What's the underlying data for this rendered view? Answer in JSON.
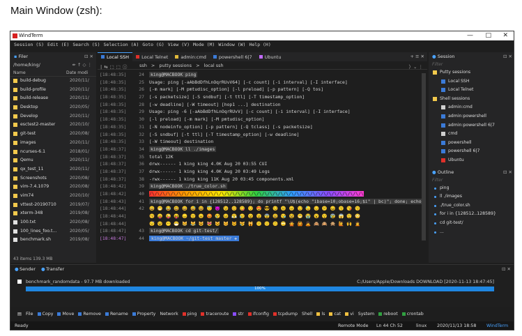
{
  "caption": "Main Window (zsh):",
  "window": {
    "title": "WindTerm",
    "min": "—",
    "max": "□",
    "close": "✕"
  },
  "menu": [
    "Session (S)",
    "Edit (E)",
    "Search (S)",
    "Selection (A)",
    "Goto (G)",
    "View (V)",
    "Mode (M)",
    "Window (W)",
    "Help (H)"
  ],
  "filer": {
    "tab": "Filer",
    "path": "/home/king/",
    "col_name": "Name",
    "col_date": "Date modi",
    "items": [
      {
        "name": "build-debug",
        "date": "2020/11/",
        "type": "folder"
      },
      {
        "name": "build-profile",
        "date": "2020/11/",
        "type": "folder"
      },
      {
        "name": "build-release",
        "date": "2020/11/",
        "type": "folder"
      },
      {
        "name": "Desktop",
        "date": "2020/05/",
        "type": "folder"
      },
      {
        "name": "Develop",
        "date": "2020/11/",
        "type": "folder"
      },
      {
        "name": "esctest2-master",
        "date": "2020/10/",
        "type": "folder"
      },
      {
        "name": "git-test",
        "date": "2020/08/",
        "type": "folder"
      },
      {
        "name": "images",
        "date": "2020/11/",
        "type": "folder"
      },
      {
        "name": "ncurses-6.1",
        "date": "2018/01/",
        "type": "folder"
      },
      {
        "name": "Qemu",
        "date": "2020/11/",
        "type": "folder"
      },
      {
        "name": "qx_test_11",
        "date": "2020/11/",
        "type": "folder"
      },
      {
        "name": "Screenshots",
        "date": "2020/08/",
        "type": "folder"
      },
      {
        "name": "vim-7.4.1079",
        "date": "2020/08/",
        "type": "folder"
      },
      {
        "name": "vim74",
        "date": "2020/10/",
        "type": "folder"
      },
      {
        "name": "vttest-20190710",
        "date": "2019/07/",
        "type": "folder"
      },
      {
        "name": "xterm-348",
        "date": "2019/08/",
        "type": "folder"
      },
      {
        "name": "100.txt",
        "date": "2020/08/",
        "type": "file"
      },
      {
        "name": "100_lines_foo.t...",
        "date": "2020/05/",
        "type": "file"
      },
      {
        "name": "benchmark.sh",
        "date": "2019/08/",
        "type": "file"
      }
    ],
    "footer": "43 items 139.3 MB"
  },
  "tabs": [
    {
      "label": "Local SSH",
      "color": "#3b7bd8",
      "active": true
    },
    {
      "label": "Local Telnet",
      "color": "#e0302a",
      "active": false
    },
    {
      "label": "admin:cmd",
      "color": "#e0b93a",
      "active": false
    },
    {
      "label": "powershell 6|7",
      "color": "#3b7bd8",
      "active": false
    },
    {
      "label": "Ubuntu",
      "color": "#c26bff",
      "active": false
    }
  ],
  "breadcrumb": [
    "ssh",
    ">",
    "putty sessions",
    ">",
    "local ssh"
  ],
  "terminal": [
    {
      "ts": "[18:48:35]",
      "ln": "24",
      "text": "king@MACBOOK  ping",
      "kind": "prompt"
    },
    {
      "ts": "[18:48:35]",
      "ln": "25",
      "text": "Usage: ping [-aAbBdDfhLnOqrRUvV64] [-c count] [-i interval] [-I interface]"
    },
    {
      "ts": "[18:48:35]",
      "ln": "26",
      "text": "            [-m mark] [-M pmtudisc_option] [-l preload] [-p pattern] [-Q tos]"
    },
    {
      "ts": "[18:48:35]",
      "ln": "27",
      "text": "            [-s packetsize] [-S sndbuf] [-t ttl] [-T timestamp_option]"
    },
    {
      "ts": "[18:48:35]",
      "ln": "28",
      "text": "            [-w deadline] [-W timeout] [hop1 ...] destination"
    },
    {
      "ts": "[18:48:35]",
      "ln": "29",
      "text": "Usage: ping -6 [-aAbBdDfhLnOqrRUvV] [-c count] [-i interval] [-I interface]"
    },
    {
      "ts": "[18:48:35]",
      "ln": "30",
      "text": "              [-l preload] [-m mark] [-M pmtudisc_option]"
    },
    {
      "ts": "[18:48:35]",
      "ln": "31",
      "text": "              [-N nodeinfo_option] [-p pattern] [-Q tclass] [-s packetsize]"
    },
    {
      "ts": "[18:48:35]",
      "ln": "32",
      "text": "              [-S sndbuf] [-t ttl] [-T timestamp_option] [-w deadline]"
    },
    {
      "ts": "[18:48:35]",
      "ln": "33",
      "text": "              [-W timeout] destination"
    },
    {
      "ts": "[18:48:37]",
      "ln": "34",
      "text": "king@MACBOOK  ll ./images",
      "kind": "prompt"
    },
    {
      "ts": "[18:48:37]",
      "ln": "35",
      "text": "total 12K"
    },
    {
      "ts": "[18:48:37]",
      "ln": "36",
      "text": "drwx------ 1 king king 4.0K Aug 20 03:55 CUI"
    },
    {
      "ts": "[18:48:37]",
      "ln": "37",
      "text": "drwx------ 1 king king 4.0K Aug 20 03:49 Logs"
    },
    {
      "ts": "[18:48:37]",
      "ln": "38",
      "text": "-rwx------ 1 king king  11K Aug 20 03:45 components.xml"
    },
    {
      "ts": "[18:48:42]",
      "ln": "39",
      "text": "king@MACBOOK  ./true_color.sh",
      "kind": "prompt"
    },
    {
      "ts": "[18:48:42]",
      "ln": "40",
      "text": "/\\/\\/\\/\\/\\/\\/\\/\\/\\/\\/\\/\\/\\/\\/\\/\\/\\/\\/\\/\\/\\/\\/\\/\\/\\/\\/\\/\\/\\/\\/\\/\\/\\/\\/\\/\\/\\/\\/\\/\\",
      "kind": "rainbow"
    },
    {
      "ts": "[18:48:43]",
      "ln": "41",
      "text": "king@MACBOOK  for i in {128512..128589}; do printf \"\\U$(echo \"ibase=10;obase=16;$i\" | bc)\"; done; echo",
      "kind": "prompt"
    },
    {
      "ts": "[18:48:44]",
      "ln": "42",
      "text": "😀 😁 😂 😃 😄 😅 😆 😇 😈 😉 😊 😋 😌 😍 😎 😏 😐 😑 😒 😓 😔 😕 😖 😗 😘 😙"
    },
    {
      "ts": "[18:48:44]",
      "ln": "",
      "text": "😚 😛 😜 😝 😞 😟 😠 😡 😢 😣 😤 😥 😦 😧 😨 😩 😪 😫 😬 😭 😮 😯 😰 😱 😲 😳"
    },
    {
      "ts": "[18:48:44]",
      "ln": "",
      "text": "😴 😵 😶 😷 😸 😹 😺 😻 😼 😽 😾 😿 🙀 🙁 🙂 🙃 🙄 🙅 🙆 🙇 🙈 🙉 🙊 🙋 🙌 🙍"
    },
    {
      "ts": "[18:48:47]",
      "ln": "43",
      "text": "king@MACBOOK  cd git-test/",
      "kind": "prompt"
    },
    {
      "ts": "[18:48:47]",
      "ln": "44",
      "text": "king@MACBOOK  ~/git-test  master ✚",
      "kind": "git"
    }
  ],
  "session_panel": {
    "tab": "Session",
    "filter": "Filter",
    "items": [
      {
        "label": "Putty sessions",
        "level": 0,
        "color": "#f2c94c"
      },
      {
        "label": "Local SSH",
        "level": 1,
        "color": "#3b7bd8"
      },
      {
        "label": "Local Telnet",
        "level": 1,
        "color": "#3b7bd8"
      },
      {
        "label": "Shell sessions",
        "level": 0,
        "color": "#f2c94c"
      },
      {
        "label": "admin:cmd",
        "level": 1,
        "color": "#cfcfcf"
      },
      {
        "label": "admin:powershell",
        "level": 1,
        "color": "#3b7bd8"
      },
      {
        "label": "admin:powershell 6|7",
        "level": 1,
        "color": "#3b7bd8"
      },
      {
        "label": "cmd",
        "level": 1,
        "color": "#cfcfcf"
      },
      {
        "label": "powershell",
        "level": 1,
        "color": "#3b7bd8"
      },
      {
        "label": "powershell 6|7",
        "level": 1,
        "color": "#3b7bd8"
      },
      {
        "label": "Ubuntu",
        "level": 1,
        "color": "#e0302a"
      }
    ]
  },
  "outline_panel": {
    "tab": "Outline",
    "filter": "Filter",
    "items": [
      "ping",
      "ll ./images",
      "./true_color.sh",
      "for i in {128512..128589}",
      "cd git-test/",
      "..."
    ]
  },
  "sender": {
    "tab_sender": "Sender",
    "tab_transfer": "Transfer",
    "file": "benchmark_randomdata - 97.7 MB downloaded",
    "dest": "C:/Users/Apple/Downloads DOWNLOAD [2020-11-13 18:47:45]",
    "progress": 1.0,
    "progress_label": "100%"
  },
  "commands": [
    {
      "label": "File",
      "color": ""
    },
    {
      "label": "Copy",
      "color": "#3b7bd8"
    },
    {
      "label": "Move",
      "color": "#3b7bd8"
    },
    {
      "label": "Remove",
      "color": "#3b7bd8"
    },
    {
      "label": "Rename",
      "color": "#3b7bd8"
    },
    {
      "label": "Property",
      "color": "#3b7bd8"
    },
    {
      "label": "Network",
      "color": ""
    },
    {
      "label": "ping",
      "color": "#e0302a"
    },
    {
      "label": "traceroute",
      "color": "#e0302a"
    },
    {
      "label": "str",
      "color": "#8a4dff"
    },
    {
      "label": "ifconfig",
      "color": "#e0302a"
    },
    {
      "label": "tcpdump",
      "color": "#e0302a"
    },
    {
      "label": "Shell",
      "color": ""
    },
    {
      "label": "ls",
      "color": "#f0c040"
    },
    {
      "label": "cat",
      "color": "#f0c040"
    },
    {
      "label": "vi",
      "color": "#f0c040"
    },
    {
      "label": "System",
      "color": ""
    },
    {
      "label": "reboot",
      "color": "#30a040"
    },
    {
      "label": "crontab",
      "color": "#30a040"
    }
  ],
  "status": {
    "left": "Ready",
    "mode": "Remote Mode",
    "pos": "Ln 44 Ch 52",
    "os": "linux",
    "time": "2020/11/13 18:58",
    "app": "WindTerm"
  }
}
